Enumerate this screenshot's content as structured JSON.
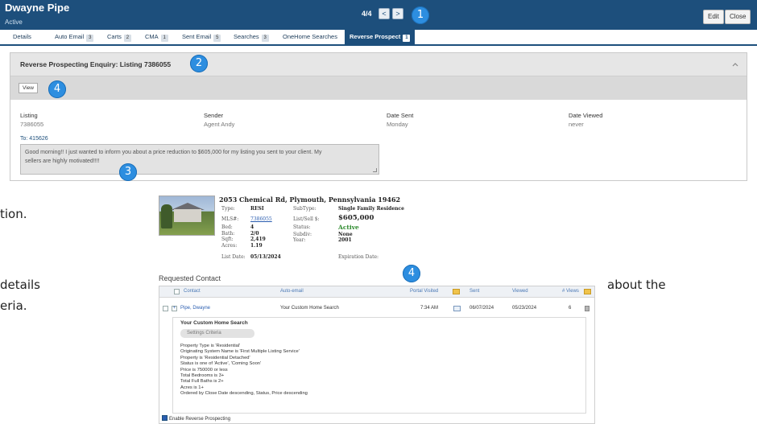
{
  "header": {
    "contact_name": "Dwayne Pipe",
    "contact_status": "Active",
    "pager_count": "4/4",
    "prev_symbol": "<",
    "next_symbol": ">",
    "edit_label": "Edit",
    "close_label": "Close",
    "brand_color": "#1d4f7c"
  },
  "tabs": [
    {
      "label": "Details",
      "count": ""
    },
    {
      "label": "Auto Email",
      "count": "3"
    },
    {
      "label": "Carts",
      "count": "2"
    },
    {
      "label": "CMA",
      "count": "1"
    },
    {
      "label": "Sent Email",
      "count": "5"
    },
    {
      "label": "Searches",
      "count": "3"
    },
    {
      "label": "OneHome Searches",
      "count": ""
    },
    {
      "label": "Reverse Prospect",
      "count": "1"
    }
  ],
  "enquiry": {
    "title": "Reverse Prospecting Enquiry: Listing 7386055",
    "view_label": "View",
    "fields": [
      {
        "label": "Listing",
        "value": "7386055"
      },
      {
        "label": "Sender",
        "value": "Agent Andy"
      },
      {
        "label": "Date Sent",
        "value": "Monday"
      },
      {
        "label": "Date Viewed",
        "value": "never"
      }
    ],
    "to_label": "To: 415626",
    "message_line1": "Good morning!! I just wanted to inform you about a price reduction to $605,000 for my listing you sent to your client. My",
    "message_line2": "sellers are highly motivated!!!!"
  },
  "background_text": {
    "line1": "tion.",
    "line2_left": "details",
    "line2_right": "about the",
    "line3": "eria."
  },
  "listing": {
    "address": "2053 Chemical Rd, Plymouth, Pennsylvania 19462",
    "type_label": "Type:",
    "type_value": "RESI",
    "subtype_label": "SubType:",
    "subtype_value": "Single Family Residence",
    "mls_label": "MLS#:",
    "mls_value": "7386055",
    "listsell_label": "List/Sell $:",
    "price": "$605,000",
    "bed_label": "Bed:",
    "bed_value": "4",
    "status_label": "Status:",
    "status_value": "Active",
    "bath_label": "Bath:",
    "bath_value": "2/0",
    "subdiv_label": "Subdiv:",
    "subdiv_value": "None",
    "sqft_label": "Sqft:",
    "sqft_value": "2,419",
    "year_label": "Year:",
    "year_value": "2001",
    "acres_label": "Acres:",
    "acres_value": "1.19",
    "listdate_label": "List Date:",
    "listdate_value": "05/13/2024",
    "expiration_label": "Expiration Date:"
  },
  "requested_contact": {
    "title": "Requested Contact",
    "columns": [
      "Contact",
      "Auto-email",
      "Portal Visited",
      "Sent",
      "Viewed",
      "# Views"
    ],
    "row": {
      "contact": "Pipe, Dwayne",
      "auto_email": "Your Custom Home Search",
      "portal_visited": "7:34 AM",
      "sent": "06/07/2024",
      "viewed": "05/23/2024",
      "views": "6"
    },
    "search_title": "Your Custom Home Search",
    "search_tabs": "Settings   Criteria",
    "criteria": [
      "Property Type is 'Residential'",
      "Originating System Name is 'First Multiple Listing Service'",
      "Property is 'Residential Detached'",
      "Status is one of 'Active', 'Coming Soon'",
      "Price is 750000 or less",
      "Total Bedrooms is 3+",
      "Total Full Baths is 2+",
      "Acres is 1+",
      "Ordered by Close Date descending, Status, Price descending"
    ],
    "enable_label": "Enable Reverse Prospecting"
  },
  "callouts": [
    "1",
    "2",
    "3",
    "4",
    "4"
  ],
  "colors": {
    "callout": "#2d8ee0",
    "active_status": "#2e8b2e",
    "link": "#2a5db0"
  }
}
